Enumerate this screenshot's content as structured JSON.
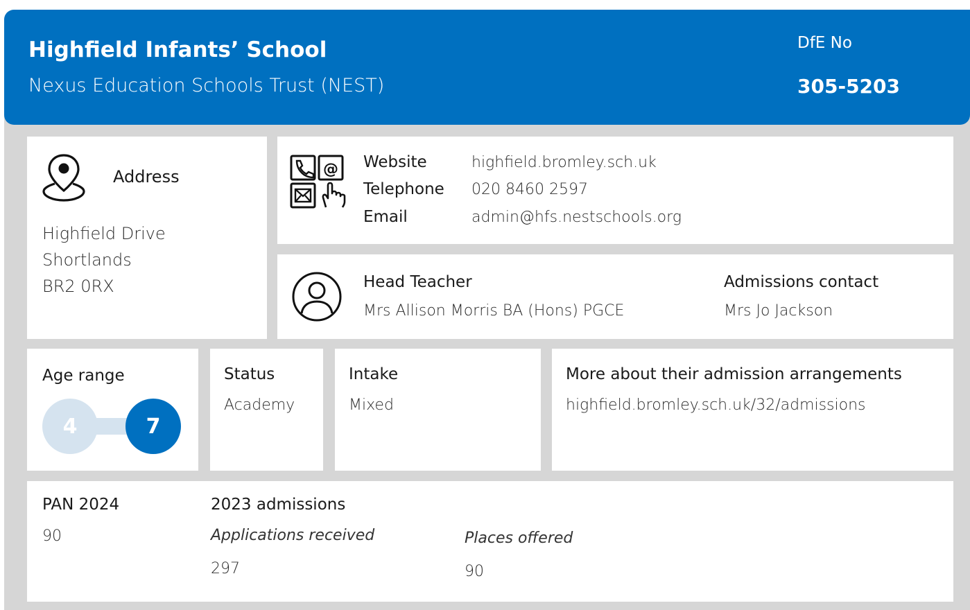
{
  "header": {
    "school_name": "Highfield Infants’ School",
    "trust_name": "Nexus Education Schools Trust (NEST)",
    "dfe_label": "DfE No",
    "dfe_number": "305-5203"
  },
  "address": {
    "title": "Address",
    "icon": "location-pin-icon",
    "lines": [
      "Highfield Drive",
      "Shortlands",
      "BR2 0RX"
    ]
  },
  "contact": {
    "icon": "contact-methods-icon",
    "website_label": "Website",
    "website": "highfield.bromley.sch.uk",
    "telephone_label": "Telephone",
    "telephone": "020 8460 2597",
    "email_label": "Email",
    "email": "admin@hfs.nestschools.org"
  },
  "people": {
    "icon": "person-icon",
    "head_label": "Head Teacher",
    "head_name": "Mrs Allison Morris BA (Hons) PGCE",
    "admissions_label": "Admissions contact",
    "admissions_name": "Mrs Jo Jackson"
  },
  "age": {
    "label": "Age range",
    "from": "4",
    "to": "7"
  },
  "status": {
    "label": "Status",
    "value": "Academy"
  },
  "intake": {
    "label": "Intake",
    "value": "Mixed"
  },
  "more": {
    "label": "More about their admission arrangements",
    "link": "highfield.bromley.sch.uk/32/admissions"
  },
  "pan": {
    "label": "PAN 2024",
    "value": "90"
  },
  "admissions": {
    "title": "2023 admissions",
    "applications_label": "Applications received",
    "applications_value": "297",
    "offered_label": "Places offered",
    "offered_value": "90"
  },
  "colors": {
    "primary": "#0070c0",
    "light": "#d5e3ef",
    "panel_bg": "#d6d6d6"
  }
}
